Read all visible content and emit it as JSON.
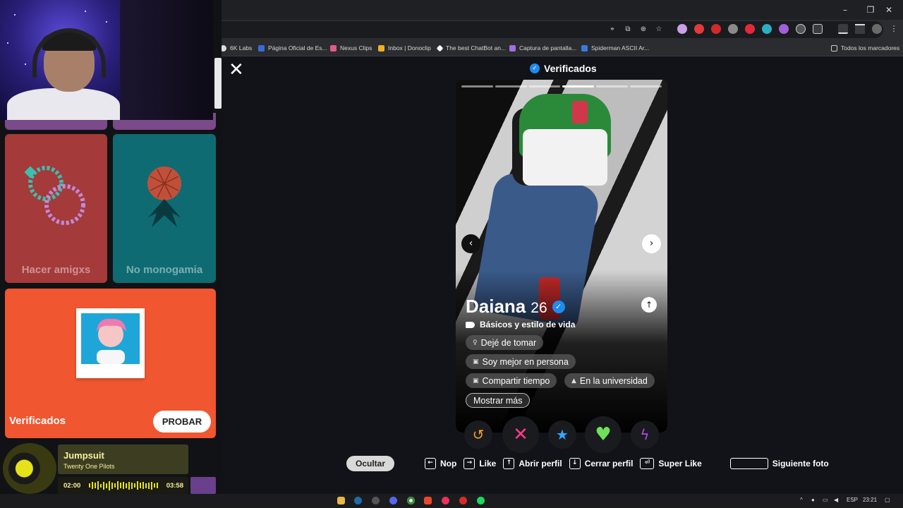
{
  "browser": {
    "window_controls": [
      "–",
      "❐",
      "✕"
    ],
    "bookmarks": [
      {
        "label": "6K Labs",
        "color": "#dddddd"
      },
      {
        "label": "Página Oficial de Es...",
        "color": "#3a6ad8"
      },
      {
        "label": "Nexus Clips",
        "color": "#e05a8a"
      },
      {
        "label": "Inbox | Donoclip",
        "color": "#f0b020"
      },
      {
        "label": "The best ChatBot an...",
        "color": "#ffffff"
      },
      {
        "label": "Captura de pantalla...",
        "color": "#a070e0"
      },
      {
        "label": "Spiderman ASCII Ar...",
        "color": "#3a7ae0"
      }
    ],
    "all_bookmarks": "Todos los marcadores"
  },
  "left_panel": {
    "tiles": [
      {
        "label": "Hacer amigxs",
        "color": "#a53a3a"
      },
      {
        "label": "No monogamia",
        "color": "#0f6b72"
      }
    ],
    "verified_tile": {
      "label": "Verificados",
      "button": "PROBAR"
    }
  },
  "spotify": {
    "title": "Jumpsuit",
    "artist": "Twenty One Pilots",
    "current_time": "02:00",
    "total_time": "03:58",
    "progress": 0.5
  },
  "tinder": {
    "header": "Verificados",
    "profile": {
      "name": "Daiana",
      "age": "26",
      "basics_label": "Básicos y estilo de vida",
      "chips": [
        {
          "label": "Dejé de tomar",
          "icon": "glass-icon"
        },
        {
          "label": "Soy mejor en persona",
          "icon": "chat-icon"
        },
        {
          "label": "Compartir tiempo",
          "icon": "chat-icon"
        },
        {
          "label": "En la universidad",
          "icon": "graduation-icon"
        }
      ],
      "more_button": "Mostrar más",
      "photo_count": 6,
      "active_photo": 4
    },
    "actions": [
      {
        "name": "rewind-button",
        "glyph": "↺",
        "color": "#f0a020"
      },
      {
        "name": "nope-button",
        "glyph": "✕",
        "color": "#ff3a8c"
      },
      {
        "name": "superlike-button",
        "glyph": "★",
        "color": "#2fa8ff"
      },
      {
        "name": "like-button",
        "glyph": "♥",
        "color": "#6fe05a"
      },
      {
        "name": "boost-button",
        "glyph": "ϟ",
        "color": "#b04ae8"
      }
    ],
    "shortcuts": {
      "hide": "Ocultar",
      "items": [
        {
          "key": "←",
          "label": "Nop"
        },
        {
          "key": "→",
          "label": "Like"
        },
        {
          "key": "↑",
          "label": "Abrir perfil"
        },
        {
          "key": "↓",
          "label": "Cerrar perfil"
        },
        {
          "key": "⏎",
          "label": "Super Like"
        },
        {
          "key": "",
          "label": "Siguiente foto"
        }
      ]
    }
  },
  "taskbar": {
    "language": "ESP",
    "time": "23:21"
  }
}
